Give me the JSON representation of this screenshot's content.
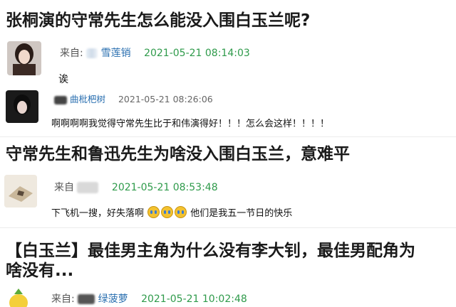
{
  "sections": [
    {
      "title": "张桐演的守常先生怎么能没入围白玉兰呢?",
      "comment": {
        "source_prefix": "来自:",
        "source_name": "雪莲销",
        "time": "2021-05-21 08:14:03",
        "text": "诶"
      },
      "reply": {
        "user": "曲枇杷树",
        "time": "2021-05-21 08:26:06",
        "text": "啊啊啊啊我觉得守常先生比于和伟演得好！！！怎么会这样！！！！"
      }
    },
    {
      "title": "守常先生和鲁迅先生为啥没入围白玉兰，意难平",
      "comment": {
        "source_prefix": "来自",
        "source_name": "",
        "time": "2021-05-21 08:53:48",
        "text_before": "下飞机一搜，好失落啊",
        "text_after": "他们是我五一节日的快乐"
      }
    },
    {
      "title_line1": "【白玉兰】最佳男主角为什么没有李大钊，最佳男配角为",
      "title_line2": "啥没有...",
      "comment": {
        "source_prefix": "来自:",
        "source_name": "绿菠萝",
        "time": "2021-05-21 10:02:48"
      }
    }
  ],
  "icons": {
    "crying_emoji": "crying-face-icon",
    "avatar_1": "woman-portrait-avatar",
    "avatar_2": "woman-dark-avatar",
    "avatar_3": "desk-photo-avatar",
    "avatar_4": "pineapple-avatar"
  }
}
